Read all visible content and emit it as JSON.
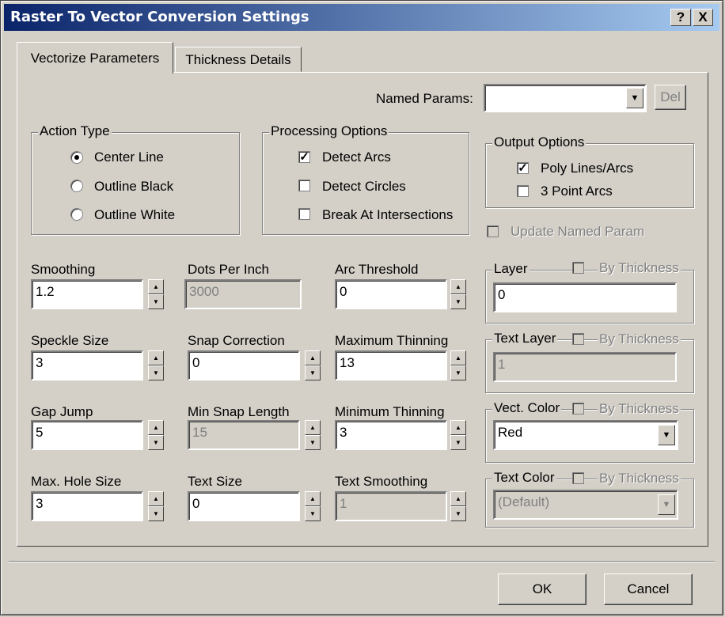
{
  "title": "Raster To Vector Conversion Settings",
  "title_buttons": {
    "help": "?",
    "close": "X"
  },
  "tabs": [
    {
      "label": "Vectorize Parameters",
      "active": true
    },
    {
      "label": "Thickness Details",
      "active": false
    }
  ],
  "named_params": {
    "label": "Named Params:",
    "value": "",
    "del_label": "Del"
  },
  "action_type": {
    "label": "Action Type",
    "options": [
      {
        "label": "Center Line",
        "checked": true
      },
      {
        "label": "Outline Black",
        "checked": false
      },
      {
        "label": "Outline White",
        "checked": false
      }
    ]
  },
  "processing_options": {
    "label": "Processing Options",
    "options": [
      {
        "label": "Detect Arcs",
        "checked": true
      },
      {
        "label": "Detect Circles",
        "checked": false
      },
      {
        "label": "Break At Intersections",
        "checked": false
      }
    ]
  },
  "output_options": {
    "label": "Output Options",
    "options": [
      {
        "label": "Poly Lines/Arcs",
        "checked": true
      },
      {
        "label": "3 Point Arcs",
        "checked": false
      }
    ]
  },
  "update_named_param": {
    "label": "Update Named Param",
    "checked": false,
    "enabled": false
  },
  "fields": {
    "smoothing": {
      "label": "Smoothing",
      "value": "1.2"
    },
    "dpi": {
      "label": "Dots Per Inch",
      "value": "3000"
    },
    "arc_threshold": {
      "label": "Arc Threshold",
      "value": "0"
    },
    "speckle": {
      "label": "Speckle Size",
      "value": "3"
    },
    "snap_correction": {
      "label": "Snap Correction",
      "value": "0"
    },
    "max_thinning": {
      "label": "Maximum Thinning",
      "value": "13"
    },
    "gap_jump": {
      "label": "Gap Jump",
      "value": "5"
    },
    "min_snap": {
      "label": "Min Snap Length",
      "value": "15"
    },
    "min_thinning": {
      "label": "Minimum Thinning",
      "value": "3"
    },
    "max_hole": {
      "label": "Max. Hole Size",
      "value": "3"
    },
    "text_size": {
      "label": "Text Size",
      "value": "0"
    },
    "text_smoothing": {
      "label": "Text Smoothing",
      "value": "1"
    }
  },
  "right_groups": {
    "by_thickness": "By Thickness",
    "layer": {
      "label": "Layer",
      "value": "0"
    },
    "text_layer": {
      "label": "Text Layer",
      "value": "1"
    },
    "vect_color": {
      "label": "Vect. Color",
      "value": "Red"
    },
    "text_color": {
      "label": "Text Color",
      "value": "(Default)"
    }
  },
  "buttons": {
    "ok": "OK",
    "cancel": "Cancel"
  }
}
